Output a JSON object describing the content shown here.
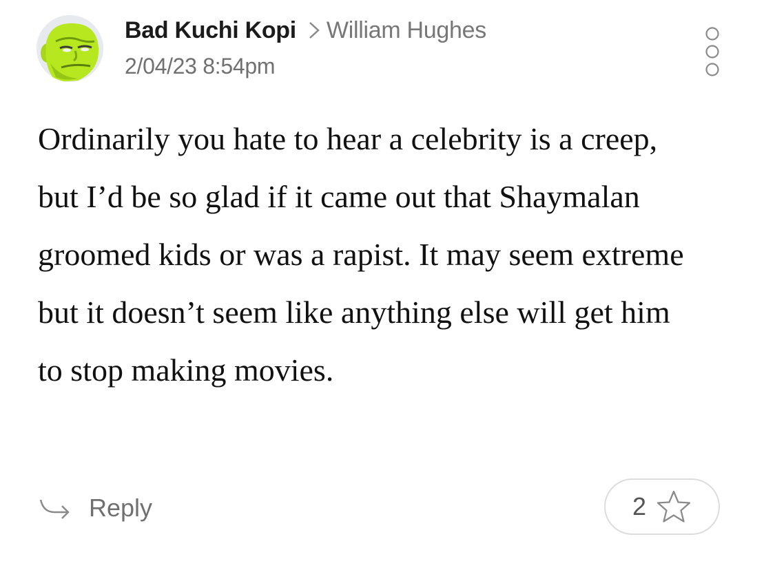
{
  "comment": {
    "author": "Bad Kuchi Kopi",
    "reply_to": "William Hughes",
    "timestamp": "2/04/23 8:54pm",
    "body": "Ordinarily you hate to hear a celebrity is a creep, but I’d be so glad if it came out that Shaymalan groomed kids or was a rapist. It may seem extreme but it doesn’t seem like anything else will get him to stop making movies."
  },
  "actions": {
    "reply_label": "Reply",
    "star_count": "2"
  },
  "icons": {
    "avatar": "avatar-green-face",
    "chevron": "chevron-right-icon",
    "more": "more-options-icon",
    "reply": "reply-arrow-icon",
    "star": "star-outline-icon"
  },
  "colors": {
    "avatar_green": "#b5e61d",
    "secondary_text": "#707070",
    "pill_border": "#dcdcdc"
  }
}
